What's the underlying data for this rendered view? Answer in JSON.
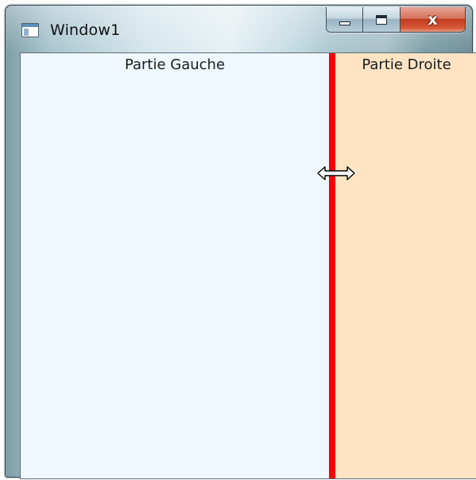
{
  "window": {
    "title": "Window1",
    "controls": {
      "minimize": "minimize",
      "maximize": "maximize",
      "close": "close"
    }
  },
  "panels": {
    "left": {
      "label": "Partie Gauche",
      "background": "#f0f8ff"
    },
    "splitter": {
      "color": "#ff0000"
    },
    "right": {
      "label": "Partie Droite",
      "background": "#ffe4c4"
    }
  },
  "cursor": {
    "icon": "resize-horizontal-icon"
  }
}
